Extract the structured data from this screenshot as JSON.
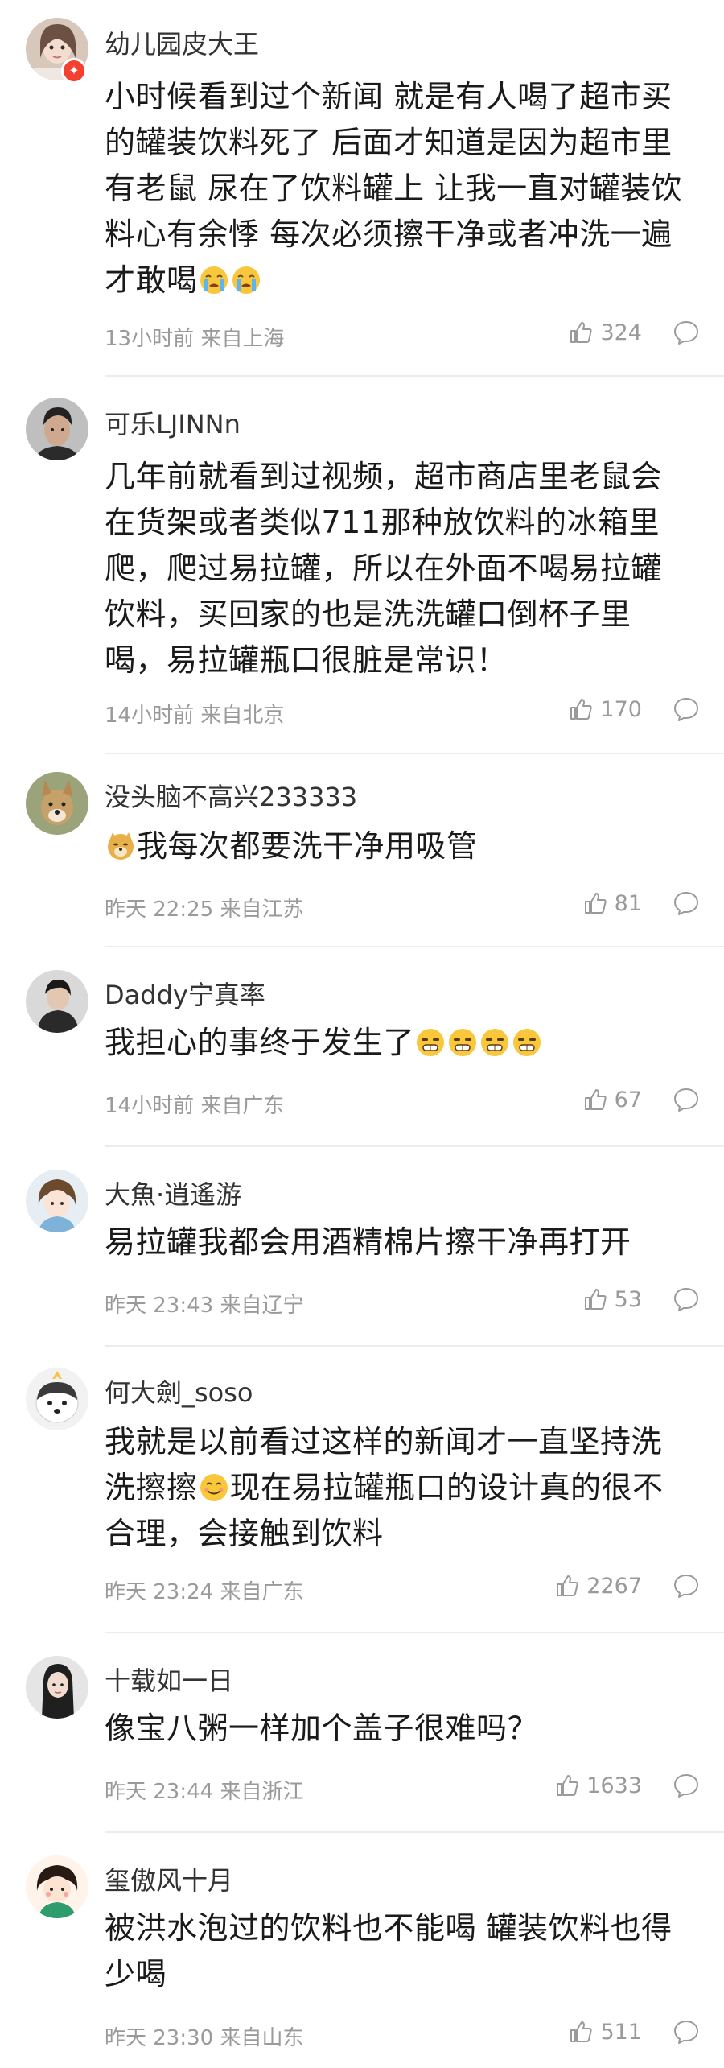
{
  "comments": [
    {
      "username": "幼儿园皮大王",
      "content_lines": [
        "小时候看到过个新闻 就是有人喝了超市买",
        "的罐装饮料死了 后面才知道是因为超市里",
        "有老鼠 尿在了饮料罐上 让我一直对罐装饮",
        "料心有余悸 每次必须擦干净或者冲洗一遍"
      ],
      "content_last": "才敢喝",
      "emoji_count": 2,
      "emoji_type": "crying",
      "time": "13小时前",
      "location": "来自上海",
      "likes": "324",
      "avatar_color": "#c9b6a8"
    },
    {
      "username": "可乐LJINNn",
      "content_lines": [
        "几年前就看到过视频，超市商店里老鼠会",
        "在货架或者类似711那种放饮料的冰箱里",
        "爬，爬过易拉罐，所以在外面不喝易拉罐",
        "饮料，买回家的也是洗洗罐口倒杯子里",
        "喝，易拉罐瓶口很脏是常识！"
      ],
      "time": "14小时前",
      "location": "来自北京",
      "likes": "170",
      "avatar_color": "#8a8a8a"
    },
    {
      "username": "没头脑不高兴233333",
      "content_text": "我每次都要洗干净用吸管",
      "emoji_type": "doge",
      "time": "昨天 22:25",
      "location": "来自江苏",
      "likes": "81",
      "avatar_color": "#b89a6a"
    },
    {
      "username": "Daddy宁真率",
      "content_text": "我担心的事终于发生了",
      "emoji_count": 4,
      "emoji_type": "speechless",
      "time": "14小时前",
      "location": "来自广东",
      "likes": "67",
      "avatar_color": "#5b5b5b"
    },
    {
      "username": "大魚·逍遙游",
      "content_text": "易拉罐我都会用酒精棉片擦干净再打开",
      "time": "昨天 23:43",
      "location": "来自辽宁",
      "likes": "53",
      "avatar_color": "#d8e6ee"
    },
    {
      "username": "何大劍_soso",
      "content_line1": "我就是以前看过这样的新闻才一直坚持洗",
      "content_line2_a": "洗擦擦",
      "content_line2_b": "现在易拉罐瓶口的设计真的很不",
      "content_line3": "合理，会接触到饮料",
      "emoji_type": "smile",
      "time": "昨天 23:24",
      "location": "来自广东",
      "likes": "2267",
      "avatar_color": "#e8e8e8"
    },
    {
      "username": "十载如一日",
      "content_text": "像宝八粥一样加个盖子很难吗？",
      "time": "昨天 23:44",
      "location": "来自浙江",
      "likes": "1633",
      "avatar_color": "#6b6b6b"
    },
    {
      "username": "玺傲风十月",
      "content_lines": [
        "被洪水泡过的饮料也不能喝 罐装饮料也得",
        "少喝"
      ],
      "time": "昨天 23:30",
      "location": "来自山东",
      "likes": "511",
      "avatar_color": "#f0c0a8"
    }
  ],
  "colors": {
    "text": "#1a1a1a",
    "meta": "#9a9a9a",
    "divider": "#ececec",
    "badge": "#f5402f"
  }
}
